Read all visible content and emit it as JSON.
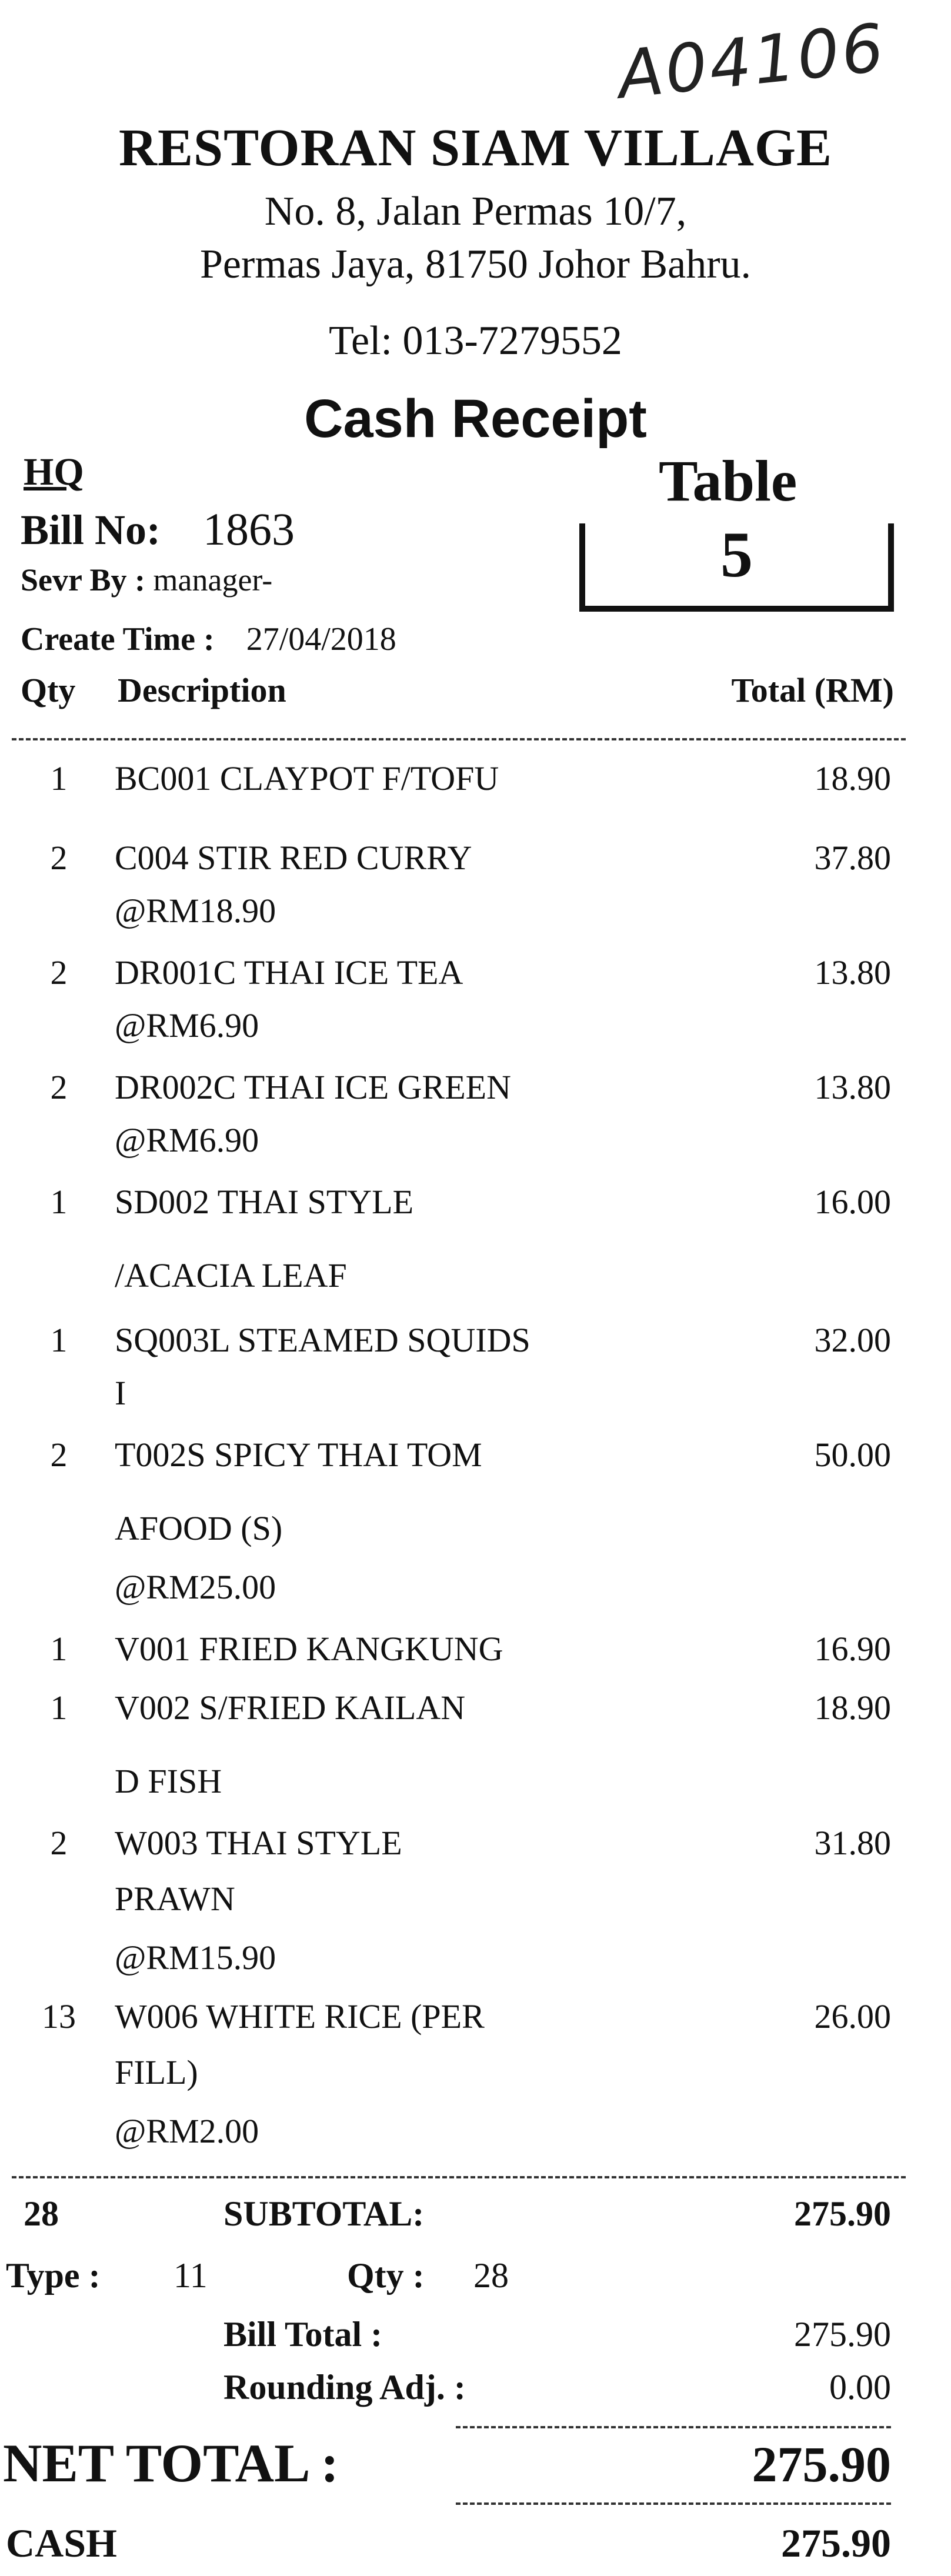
{
  "stamp": "A04106",
  "store": {
    "name": "RESTORAN SIAM VILLAGE",
    "address_line1": "No. 8, Jalan Permas 10/7,",
    "address_line2": "Permas Jaya, 81750 Johor Bahru.",
    "tel": "Tel: 013-7279552"
  },
  "receipt_title": "Cash Receipt",
  "outlet": "HQ",
  "table": {
    "label": "Table",
    "number": "5"
  },
  "bill": {
    "label": "Bill No:",
    "number": "1863",
    "server_label": "Sevr By :",
    "server": "manager-",
    "create_label": "Create Time :",
    "create_time": "27/04/2018"
  },
  "columns": {
    "qty": "Qty",
    "description": "Description",
    "total": "Total (RM)"
  },
  "items": [
    {
      "qty": "1",
      "desc": "BC001 CLAYPOT F/TOFU",
      "total": "18.90"
    },
    {
      "qty": "2",
      "desc": "C004 STIR RED CURRY",
      "total": "37.80"
    },
    {
      "desc": "@RM18.90"
    },
    {
      "qty": "2",
      "desc": "DR001C THAI ICE TEA",
      "total": "13.80"
    },
    {
      "desc": "@RM6.90"
    },
    {
      "qty": "2",
      "desc": "DR002C THAI ICE GREEN",
      "total": "13.80"
    },
    {
      "desc": "@RM6.90"
    },
    {
      "qty": "1",
      "desc": "SD002 THAI STYLE",
      "total": "16.00"
    },
    {
      "desc": "/ACACIA LEAF"
    },
    {
      "qty": "1",
      "desc": "SQ003L STEAMED SQUIDS",
      "total": "32.00"
    },
    {
      "desc": "I"
    },
    {
      "qty": "2",
      "desc": "T002S SPICY THAI TOM",
      "total": "50.00"
    },
    {
      "desc": "AFOOD (S)"
    },
    {
      "desc": "@RM25.00"
    },
    {
      "qty": "1",
      "desc": "V001 FRIED KANGKUNG",
      "total": "16.90"
    },
    {
      "qty": "1",
      "desc": "V002 S/FRIED KAILAN",
      "total": "18.90"
    },
    {
      "desc": "D FISH"
    },
    {
      "qty": "2",
      "desc": "W003 THAI STYLE",
      "total": "31.80"
    },
    {
      "desc": "PRAWN"
    },
    {
      "desc": "@RM15.90"
    },
    {
      "qty": "13",
      "desc": "W006 WHITE RICE (PER",
      "total": "26.00"
    },
    {
      "desc": "FILL)"
    },
    {
      "desc": "@RM2.00"
    }
  ],
  "summary": {
    "total_qty": "28",
    "subtotal_label": "SUBTOTAL:",
    "subtotal": "275.90",
    "type_label": "Type :",
    "type": "11",
    "qty_label": "Qty :",
    "qty": "28",
    "bill_total_label": "Bill Total :",
    "bill_total": "275.90",
    "rounding_label": "Rounding Adj. :",
    "rounding": "0.00",
    "net_total_label": "NET TOTAL :",
    "net_total": "275.90",
    "cash_label": "CASH",
    "cash": "275.90"
  }
}
